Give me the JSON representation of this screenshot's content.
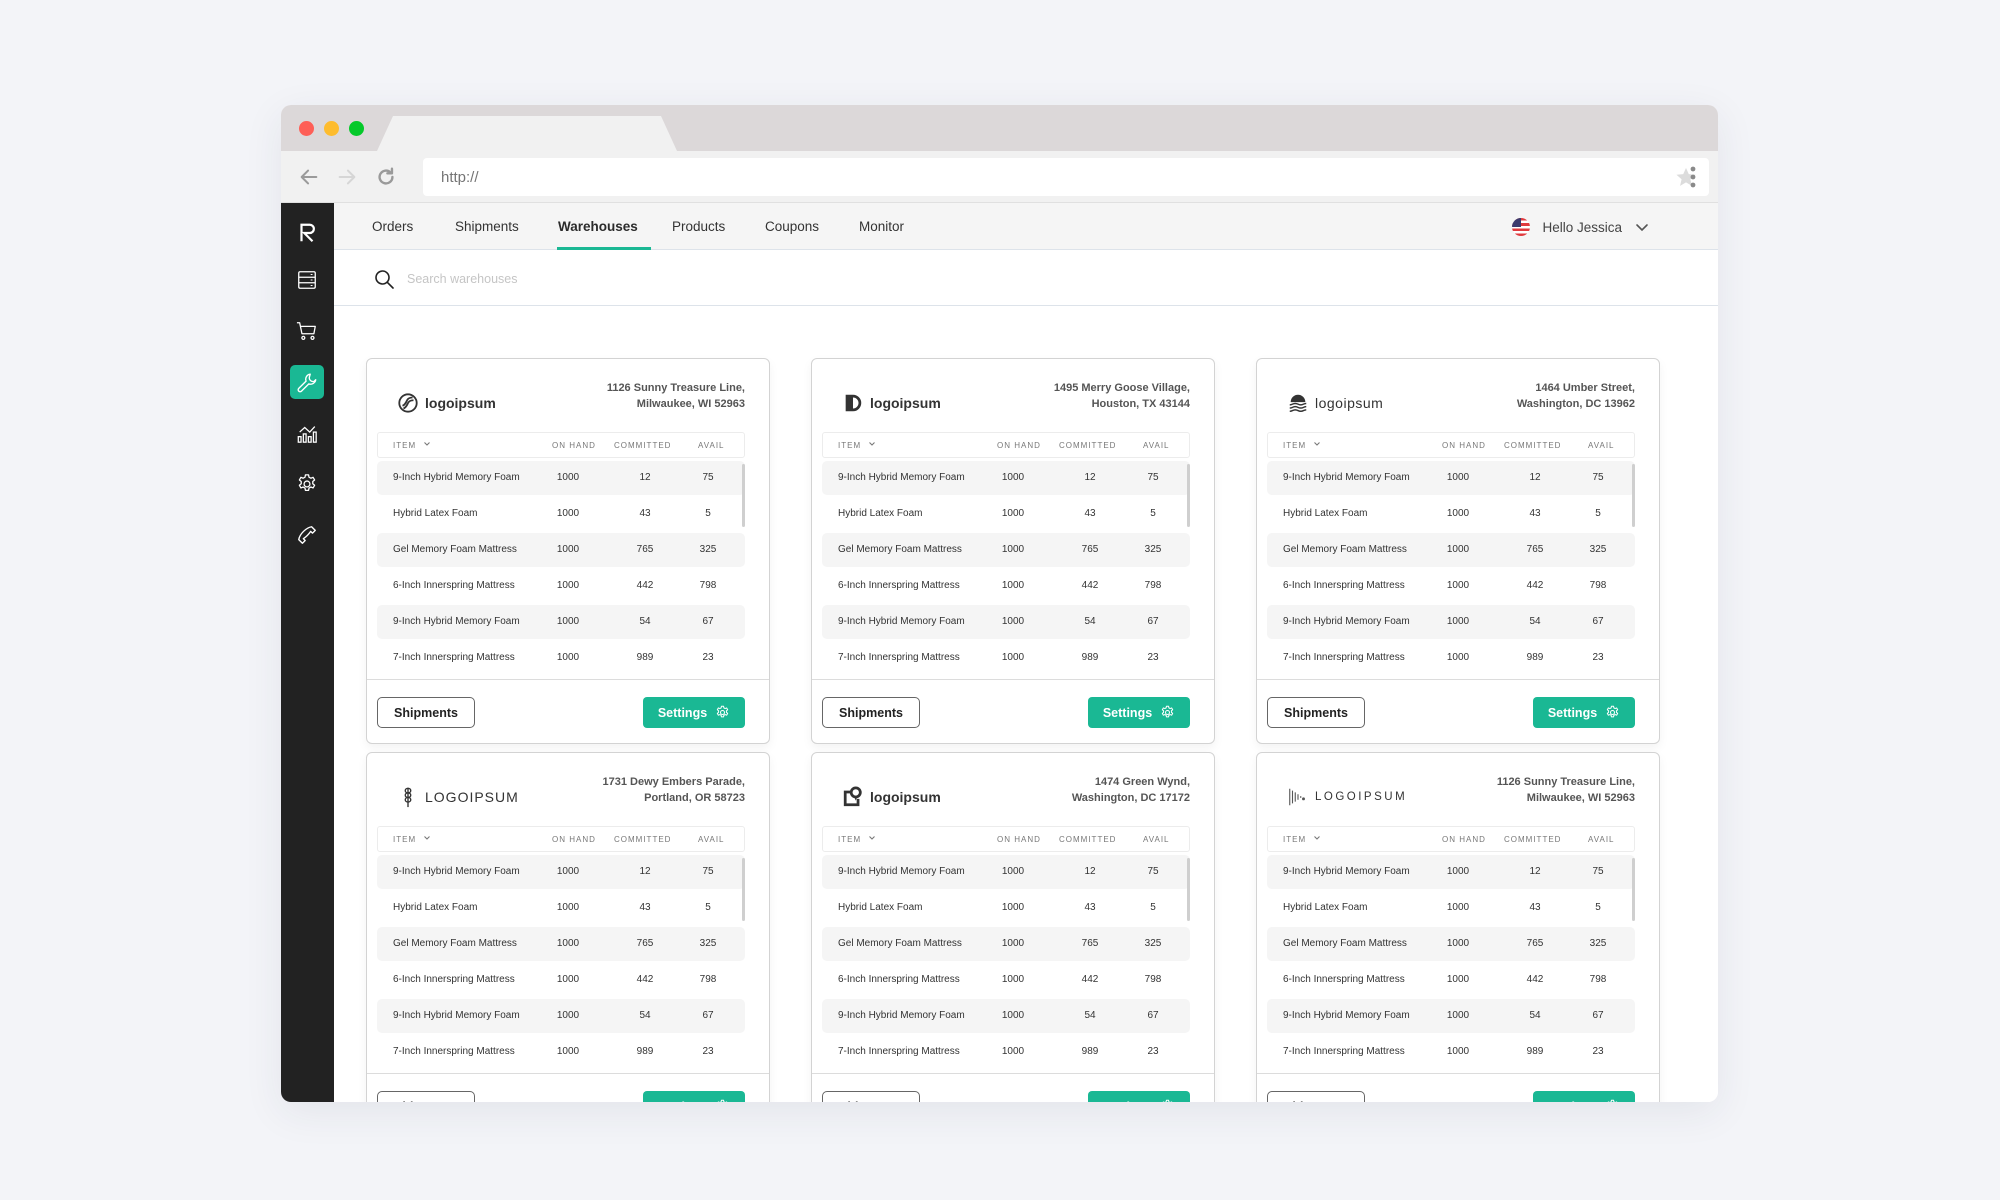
{
  "browser": {
    "url_placeholder": "http://",
    "icons": [
      "back-arrow-icon",
      "forward-arrow-icon",
      "reload-icon",
      "star-icon",
      "kebab-menu-icon"
    ]
  },
  "sidebar": {
    "items": [
      {
        "name": "logo",
        "icon": "brand-r-logo-icon",
        "active": false
      },
      {
        "name": "inventory",
        "icon": "server-stack-icon",
        "active": false
      },
      {
        "name": "cart",
        "icon": "shopping-cart-icon",
        "active": false
      },
      {
        "name": "tools",
        "icon": "wrench-icon",
        "active": true
      },
      {
        "name": "analytics",
        "icon": "chart-icon",
        "active": false
      },
      {
        "name": "settings",
        "icon": "gear-icon",
        "active": false
      },
      {
        "name": "support",
        "icon": "phone-icon",
        "active": false
      }
    ],
    "accent_color": "#1ab894"
  },
  "topnav": {
    "tabs": [
      {
        "label": "Orders",
        "active": false
      },
      {
        "label": "Shipments",
        "active": false
      },
      {
        "label": "Warehouses",
        "active": true
      },
      {
        "label": "Products",
        "active": false
      },
      {
        "label": "Coupons",
        "active": false
      },
      {
        "label": "Monitor",
        "active": false
      }
    ],
    "user_greeting": "Hello Jessica",
    "flag": "us-flag-icon"
  },
  "search": {
    "placeholder": "Search warehouses",
    "value": ""
  },
  "table_headers": {
    "item": "ITEM",
    "on_hand": "ON HAND",
    "committed": "COMMITTED",
    "avail": "AVAIL"
  },
  "buttons": {
    "shipments": "Shipments",
    "settings": "Settings"
  },
  "warehouses": [
    {
      "logo_text": "logoipsum",
      "logo_icon": "circle-slash-logo-icon",
      "address_line1": "1126 Sunny Treasure Line,",
      "address_line2": "Milwaukee, WI 52963",
      "rows": [
        {
          "item": "9-Inch Hybrid Memory Foam",
          "on_hand": "1000",
          "committed": "12",
          "avail": "75"
        },
        {
          "item": "Hybrid Latex Foam",
          "on_hand": "1000",
          "committed": "43",
          "avail": "5"
        },
        {
          "item": "Gel Memory Foam Mattress",
          "on_hand": "1000",
          "committed": "765",
          "avail": "325"
        },
        {
          "item": "6-Inch Innerspring Mattress",
          "on_hand": "1000",
          "committed": "442",
          "avail": "798"
        },
        {
          "item": "9-Inch Hybrid Memory Foam",
          "on_hand": "1000",
          "committed": "54",
          "avail": "67"
        },
        {
          "item": "7-Inch Innerspring Mattress",
          "on_hand": "1000",
          "committed": "989",
          "avail": "23"
        }
      ]
    },
    {
      "logo_text": "logoipsum",
      "logo_icon": "half-circle-logo-icon",
      "address_line1": "1495 Merry Goose Village,",
      "address_line2": "Houston, TX 43144",
      "rows": [
        {
          "item": "9-Inch Hybrid Memory Foam",
          "on_hand": "1000",
          "committed": "12",
          "avail": "75"
        },
        {
          "item": "Hybrid Latex Foam",
          "on_hand": "1000",
          "committed": "43",
          "avail": "5"
        },
        {
          "item": "Gel Memory Foam Mattress",
          "on_hand": "1000",
          "committed": "765",
          "avail": "325"
        },
        {
          "item": "6-Inch Innerspring Mattress",
          "on_hand": "1000",
          "committed": "442",
          "avail": "798"
        },
        {
          "item": "9-Inch Hybrid Memory Foam",
          "on_hand": "1000",
          "committed": "54",
          "avail": "67"
        },
        {
          "item": "7-Inch Innerspring Mattress",
          "on_hand": "1000",
          "committed": "989",
          "avail": "23"
        }
      ]
    },
    {
      "logo_text": "logoipsum",
      "logo_icon": "sunset-waves-logo-icon",
      "address_line1": "1464 Umber Street,",
      "address_line2": "Washington, DC 13962",
      "rows": [
        {
          "item": "9-Inch Hybrid Memory Foam",
          "on_hand": "1000",
          "committed": "12",
          "avail": "75"
        },
        {
          "item": "Hybrid Latex Foam",
          "on_hand": "1000",
          "committed": "43",
          "avail": "5"
        },
        {
          "item": "Gel Memory Foam Mattress",
          "on_hand": "1000",
          "committed": "765",
          "avail": "325"
        },
        {
          "item": "6-Inch Innerspring Mattress",
          "on_hand": "1000",
          "committed": "442",
          "avail": "798"
        },
        {
          "item": "9-Inch Hybrid Memory Foam",
          "on_hand": "1000",
          "committed": "54",
          "avail": "67"
        },
        {
          "item": "7-Inch Innerspring Mattress",
          "on_hand": "1000",
          "committed": "989",
          "avail": "23"
        }
      ]
    },
    {
      "logo_text": "LOGOIPSUM",
      "logo_icon": "wheat-logo-icon",
      "address_line1": "1731 Dewy Embers Parade,",
      "address_line2": "Portland, OR 58723",
      "rows": [
        {
          "item": "9-Inch Hybrid Memory Foam",
          "on_hand": "1000",
          "committed": "12",
          "avail": "75"
        },
        {
          "item": "Hybrid Latex Foam",
          "on_hand": "1000",
          "committed": "43",
          "avail": "5"
        },
        {
          "item": "Gel Memory Foam Mattress",
          "on_hand": "1000",
          "committed": "765",
          "avail": "325"
        },
        {
          "item": "6-Inch Innerspring Mattress",
          "on_hand": "1000",
          "committed": "442",
          "avail": "798"
        },
        {
          "item": "9-Inch Hybrid Memory Foam",
          "on_hand": "1000",
          "committed": "54",
          "avail": "67"
        },
        {
          "item": "7-Inch Innerspring Mattress",
          "on_hand": "1000",
          "committed": "989",
          "avail": "23"
        }
      ]
    },
    {
      "logo_text": "logoipsum",
      "logo_icon": "square-pin-logo-icon",
      "address_line1": "1474 Green Wynd,",
      "address_line2": "Washington, DC 17172",
      "rows": [
        {
          "item": "9-Inch Hybrid Memory Foam",
          "on_hand": "1000",
          "committed": "12",
          "avail": "75"
        },
        {
          "item": "Hybrid Latex Foam",
          "on_hand": "1000",
          "committed": "43",
          "avail": "5"
        },
        {
          "item": "Gel Memory Foam Mattress",
          "on_hand": "1000",
          "committed": "765",
          "avail": "325"
        },
        {
          "item": "6-Inch Innerspring Mattress",
          "on_hand": "1000",
          "committed": "442",
          "avail": "798"
        },
        {
          "item": "9-Inch Hybrid Memory Foam",
          "on_hand": "1000",
          "committed": "54",
          "avail": "67"
        },
        {
          "item": "7-Inch Innerspring Mattress",
          "on_hand": "1000",
          "committed": "989",
          "avail": "23"
        }
      ]
    },
    {
      "logo_text": "LOGOIPSUM",
      "logo_icon": "bars-logo-icon",
      "address_line1": "1126 Sunny Treasure Line,",
      "address_line2": "Milwaukee, WI 52963",
      "rows": [
        {
          "item": "9-Inch Hybrid Memory Foam",
          "on_hand": "1000",
          "committed": "12",
          "avail": "75"
        },
        {
          "item": "Hybrid Latex Foam",
          "on_hand": "1000",
          "committed": "43",
          "avail": "5"
        },
        {
          "item": "Gel Memory Foam Mattress",
          "on_hand": "1000",
          "committed": "765",
          "avail": "325"
        },
        {
          "item": "6-Inch Innerspring Mattress",
          "on_hand": "1000",
          "committed": "442",
          "avail": "798"
        },
        {
          "item": "9-Inch Hybrid Memory Foam",
          "on_hand": "1000",
          "committed": "54",
          "avail": "67"
        },
        {
          "item": "7-Inch Innerspring Mattress",
          "on_hand": "1000",
          "committed": "989",
          "avail": "23"
        }
      ]
    }
  ]
}
